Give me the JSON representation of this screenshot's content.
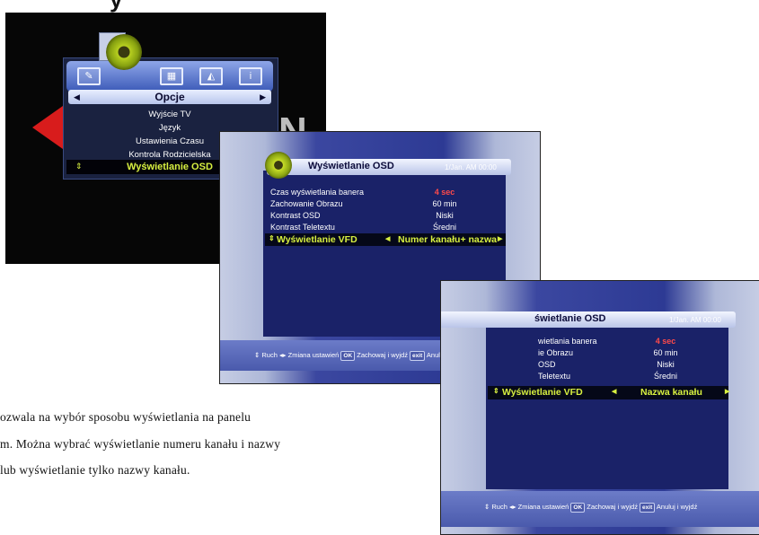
{
  "title_fragment": "y",
  "main_menu": {
    "section_label": "Opcje",
    "items": [
      "Wyjście TV",
      "Język",
      "Ustawienia Czasu",
      "Kontrola Rodzicielska"
    ],
    "selected_item": "Wyświetlanie OSD",
    "logo_text": "N"
  },
  "osd_screen_1": {
    "title": "Wyświetlanie OSD",
    "datetime": "1/Jan. AM 00:00",
    "rows": [
      {
        "label": "Czas wyświetlania banera",
        "value": "4 sec"
      },
      {
        "label": "Zachowanie Obrazu",
        "value": "60 min"
      },
      {
        "label": "Kontrast OSD",
        "value": "Niski"
      },
      {
        "label": "Kontrast Teletextu",
        "value": "Średni"
      }
    ],
    "vfd": {
      "label": "Wyświetlanie VFD",
      "value": "Numer kanału+ nazwa"
    },
    "footer": {
      "move": "Ruch",
      "change": "Zmiana ustawień",
      "ok_badge": "OK",
      "save": "Zachowaj i wyjdź",
      "exit_badge": "exit",
      "cancel": "Anuluj i wyjdź"
    }
  },
  "osd_screen_2": {
    "title": "świetlanie OSD",
    "datetime": "1/Jan. AM 00:00",
    "rows": [
      {
        "label": "wietlania banera",
        "value": "4 sec"
      },
      {
        "label": "ie Obrazu",
        "value": "60 min"
      },
      {
        "label": "OSD",
        "value": "Niski"
      },
      {
        "label": "Teletextu",
        "value": "Średni"
      }
    ],
    "vfd": {
      "label": "Wyświetlanie VFD",
      "value": "Nazwa kanału"
    },
    "footer": {
      "move": "Ruch",
      "change": "Zmiana ustawień",
      "ok_badge": "OK",
      "save": "Zachowaj i wyjdź",
      "exit_badge": "exit",
      "cancel": "Anuluj i wyjdź"
    }
  },
  "body_text": {
    "line1": "ozwala na wybór sposobu wyświetlania na panelu",
    "line2": "m. Można wybrać wyświetlanie numeru kanału i nazwy",
    "line3": "lub wyświetlanie tylko nazwy kanału."
  },
  "colors": {
    "highlight": "#d8f040",
    "value_red": "#ff4a4a",
    "menu_bg": "#1a2268"
  }
}
